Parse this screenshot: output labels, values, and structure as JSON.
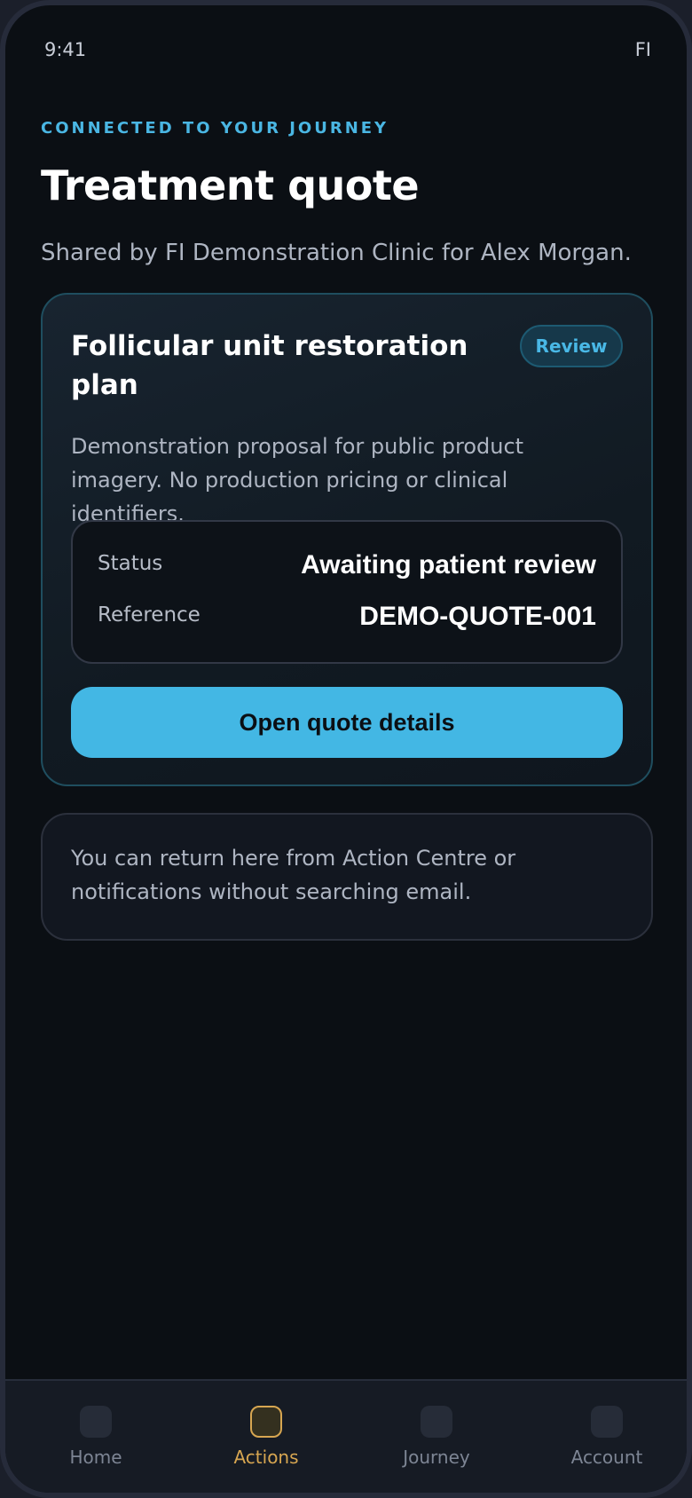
{
  "status_bar": {
    "time": "9:41",
    "initials": "FI"
  },
  "header": {
    "eyebrow": "CONNECTED TO YOUR JOURNEY",
    "title": "Treatment quote",
    "subtitle": "Shared by FI Demonstration Clinic for Alex Morgan."
  },
  "quote_card": {
    "plan_title": "Follicular unit restoration plan",
    "badge": "Review",
    "description": "Demonstration proposal for public product imagery. No production pricing or clinical identifiers.",
    "status_label": "Status",
    "status_value": "Awaiting patient review",
    "reference_label": "Reference",
    "reference_value": "DEMO-QUOTE-001",
    "button_label": "Open quote details"
  },
  "info_card": {
    "text": "You can return here from Action Centre or notifications without searching email."
  },
  "bottom_nav": {
    "active": "Actions",
    "items": [
      {
        "label": "Home",
        "icon": "home-icon"
      },
      {
        "label": "Actions",
        "icon": "actions-icon"
      },
      {
        "label": "Journey",
        "icon": "journey-icon"
      },
      {
        "label": "Account",
        "icon": "account-icon"
      }
    ]
  },
  "colors": {
    "accent": "#43b7e4",
    "active_nav": "#d7a651",
    "background": "#0b0f14"
  }
}
